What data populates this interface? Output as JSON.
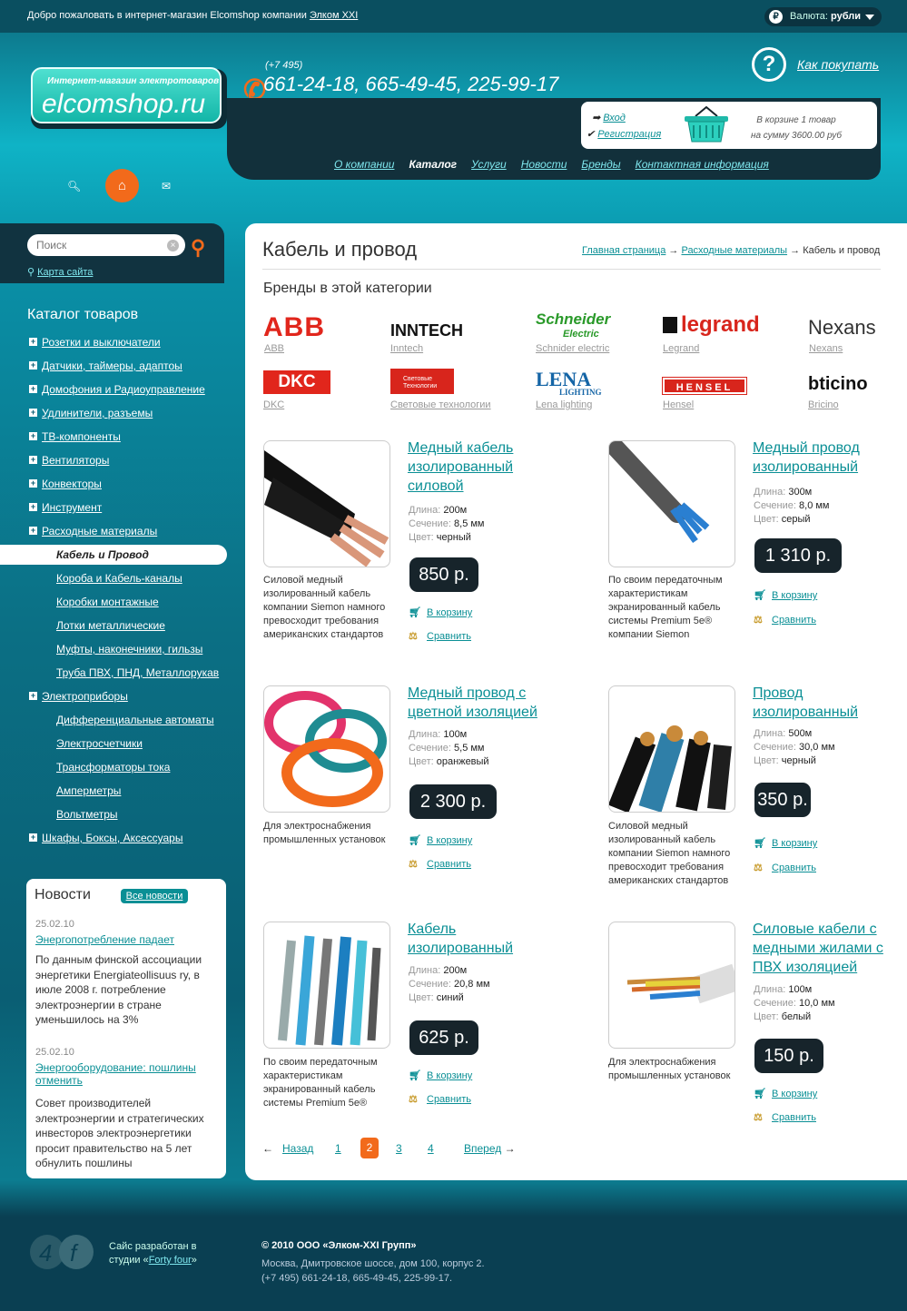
{
  "topbar": {
    "welcome": "Добро пожаловать в интернет-магазин Elcomshop компании ",
    "welcome_link": "Элком XXI",
    "currency_label": "Валюта:",
    "currency_value": "рубли",
    "currency_symbol": "₽"
  },
  "logo": {
    "subtitle": "Интернет-магазин электротоваров",
    "name": "elcomshop.ru"
  },
  "contacts": {
    "code": "(+7 495)",
    "phones": "661-24-18, 665-49-45, 225-99-17"
  },
  "how_to_buy": "Как покупать",
  "account": {
    "login": "Вход",
    "register": "Регистрация"
  },
  "cart": {
    "line1": "В корзине 1 товар",
    "line2": "на сумму 3600.00 руб"
  },
  "nav": {
    "items": [
      "О компании",
      "Каталог",
      "Услуги",
      "Новости",
      "Бренды",
      "Контактная информация"
    ],
    "active": "Каталог"
  },
  "search": {
    "placeholder": "Поиск",
    "sitemap": "Карта сайта"
  },
  "catalog": {
    "title": "Каталог товаров",
    "items": [
      "Розетки и выключатели",
      "Датчики, таймеры, адаптоы",
      "Домофония и Радиоуправление",
      "Удлинители, разъемы",
      "ТВ-компоненты",
      "Вентиляторы",
      "Конвекторы",
      "Инструмент",
      "Расходные материалы"
    ],
    "sub_active": "Кабель и Провод",
    "subs": [
      "Короба и Кабель-каналы",
      "Коробки монтажные",
      "Лотки металлические",
      "Муфты, наконечники, гильзы",
      "Труба ПВХ, ПНД, Металлорукав"
    ],
    "item2": "Электроприборы",
    "subs2": [
      "Дифференциальные автоматы",
      "Электросчетчики",
      "Трансформаторы тока",
      "Амперметры",
      "Вольтметры"
    ],
    "item3": "Шкафы, Боксы, Аксессуары"
  },
  "news": {
    "title": "Новости",
    "all": "Все новости",
    "items": [
      {
        "date": "25.02.10",
        "title": "Энергопотребление падает",
        "text": "По данным финской ассоциации энергетики Energiateollisuus ry, в июле 2008 г. потребление электроэнергии в стране уменьшилось на 3%"
      },
      {
        "date": "25.02.10",
        "title": "Энергооборудование: пошлины отменить",
        "text": "Совет производителей электроэнергии и стратегических инвесторов электроэнергетики просит правительство на 5 лет обнулить пошлины"
      }
    ]
  },
  "page": {
    "title": "Кабель и провод",
    "crumb1": "Главная страница",
    "crumb2": "Расходные материалы",
    "crumb3": "Кабель и провод",
    "arrow": "→",
    "brands_title": "Бренды в этой категории"
  },
  "brands": [
    {
      "logo": "ABB",
      "name": "ABB"
    },
    {
      "logo": "INNTECH",
      "name": "Inntech"
    },
    {
      "logo": "Schneider",
      "logo2": "Electric",
      "name": "Schnider electric"
    },
    {
      "logo": "legrand",
      "name": "Legrand"
    },
    {
      "logo": "Nexans",
      "name": "Nexans"
    },
    {
      "logo": "DKC",
      "name": "DKC"
    },
    {
      "logo": "Световые Технологии",
      "name": "Световые технологии"
    },
    {
      "logo": "LENA",
      "logo2": "LIGHTING",
      "name": "Lena lighting"
    },
    {
      "logo": "HENSEL",
      "name": "Hensel"
    },
    {
      "logo": "bticino",
      "name": "Bricino"
    }
  ],
  "labels": {
    "length": "Длина:",
    "section": "Сечение:",
    "color": "Цвет:",
    "to_cart": "В корзину",
    "compare": "Сравнить"
  },
  "products": [
    {
      "title": "Медный кабель изолированный силовой",
      "length": "200м",
      "section": "8,5 мм",
      "color": "черный",
      "price": "850 р.",
      "desc": "Силовой медный изолированный кабель компании Siemon намного превосходит требования американских стандартов"
    },
    {
      "title": "Медный провод изолированный",
      "length": "300м",
      "section": "8,0 мм",
      "color": "серый",
      "price": "1 310 р.",
      "desc": "По своим передаточным характеристикам экранированный кабель системы Premium 5e® компании Siemon"
    },
    {
      "title": "Медный провод с цветной изоляцией",
      "length": "100м",
      "section": "5,5 мм",
      "color": "оранжевый",
      "price": "2 300 р.",
      "desc": "Для электроснабжения промышленных установок"
    },
    {
      "title": "Провод изолированный",
      "length": "500м",
      "section": "30,0 мм",
      "color": "черный",
      "price": "350 р.",
      "desc": "Силовой медный изолированный кабель компании Siemon намного превосходит требования американских стандартов"
    },
    {
      "title": "Кабель изолированный",
      "length": "200м",
      "section": "20,8 мм",
      "color": "синий",
      "price": "625 р.",
      "desc": "По своим передаточным характеристикам экранированный кабель системы Premium 5e®"
    },
    {
      "title": "Силовые кабели с медными жилами с ПВХ изоляцией",
      "length": "100м",
      "section": "10,0 мм",
      "color": "белый",
      "price": "150 р.",
      "desc": "Для электроснабжения промышленных установок"
    }
  ],
  "pager": {
    "prev": "Назад",
    "next": "Вперед",
    "pages": [
      "1",
      "2",
      "3",
      "4"
    ],
    "current": "2",
    "prev_arrow": "←",
    "next_arrow": "→"
  },
  "footer": {
    "dev1": "Сайс разработан в",
    "dev2": "студии «",
    "dev_link": "Forty four",
    "dev3": "»",
    "logo": "4f",
    "copy": "© 2010 ООО «Элком-XXI Групп»",
    "addr": "Москва, Дмитровское шоссе, дом 100, корпус 2.",
    "phones": "(+7 495) 661-24-18, 665-49-45, 225-99-17."
  },
  "colors": {
    "accent": "#0a8f95",
    "orange": "#f26a1b",
    "dark": "#17242b"
  }
}
